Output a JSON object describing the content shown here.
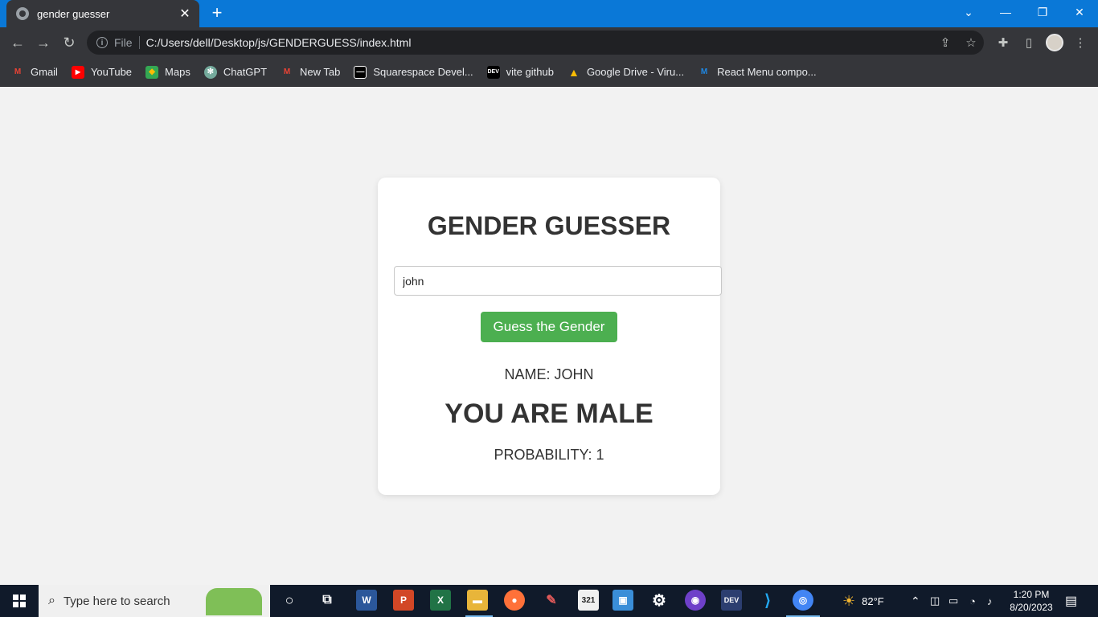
{
  "browser": {
    "tab_title": "gender guesser",
    "scheme_label": "File",
    "url": "C:/Users/dell/Desktop/js/GENDERGUESS/index.html",
    "bookmarks": [
      {
        "label": "Gmail",
        "icon": "gmail-icon"
      },
      {
        "label": "YouTube",
        "icon": "youtube-icon"
      },
      {
        "label": "Maps",
        "icon": "maps-icon"
      },
      {
        "label": "ChatGPT",
        "icon": "chatgpt-icon"
      },
      {
        "label": "New Tab",
        "icon": "gmail-icon"
      },
      {
        "label": "Squarespace Devel...",
        "icon": "squarespace-icon"
      },
      {
        "label": "vite github",
        "icon": "dev-icon"
      },
      {
        "label": "Google Drive - Viru...",
        "icon": "drive-icon"
      },
      {
        "label": "React Menu compo...",
        "icon": "react-menu-icon"
      }
    ]
  },
  "app": {
    "title": "GENDER GUESSER",
    "input_value": "john",
    "button_label": "Guess the Gender",
    "name_line": "NAME: JOHN",
    "result_line": "YOU ARE MALE",
    "probability_line": "PROBABILITY: 1",
    "accent_color": "#4caf50"
  },
  "taskbar": {
    "search_placeholder": "Type here to search",
    "weather": "82°F",
    "time": "1:20 PM",
    "date": "8/20/2023"
  }
}
